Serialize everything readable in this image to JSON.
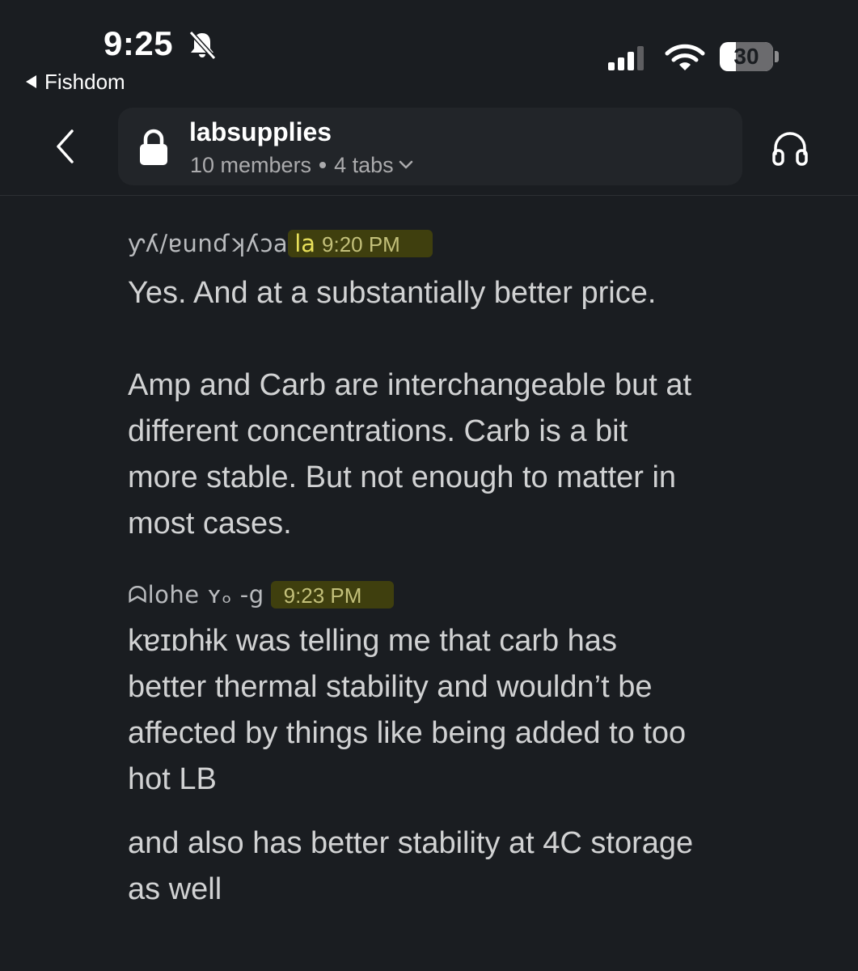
{
  "status_bar": {
    "time": "9:25",
    "back_app": "Fishdom",
    "battery_percent": "30",
    "battery_level": 0.3,
    "icons": [
      "bell-slash-icon",
      "signal-icon",
      "wifi-icon",
      "battery-icon"
    ]
  },
  "header": {
    "channel_name": "labsupplies",
    "members": "10 members",
    "tabs": "4 tabs",
    "icons": [
      "back-arrow-icon",
      "lock-icon",
      "chevron-down-icon",
      "headphones-icon"
    ]
  },
  "messages": [
    {
      "sender": "ƴʎ/ɐunɗʞʎɔa",
      "sender_tail": "la",
      "time": "9:20 PM",
      "paragraphs": [
        "Yes. And at a substantially better price.",
        "\nAmp and Carb are interchangeable but at\ndifferent concentrations. Carb is a bit\nmore stable. But not enough to matter in\nmost cases."
      ]
    },
    {
      "sender": "ᗣlohe ʏₒ -g",
      "sender_tail": "",
      "time": "9:23 PM",
      "paragraphs": [
        "kɐɪɒhɨk was telling me that carb has\nbetter thermal stability and wouldn’t be\naffected by things like being added to too\nhot LB",
        "and also has better stability at 4C storage\nas well"
      ]
    }
  ],
  "colors": {
    "background": "#1a1d21",
    "header_box": "#222529",
    "text": "#d1d2d3",
    "timestamp_highlight": "#3f3f0e"
  }
}
